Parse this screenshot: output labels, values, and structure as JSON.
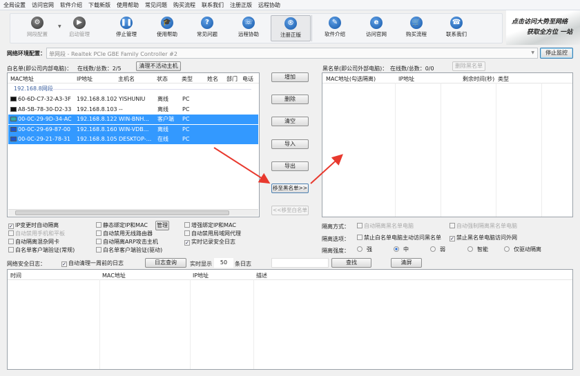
{
  "menu": [
    "全局设置",
    "访问官网",
    "软件介绍",
    "下载新版",
    "使用帮助",
    "常见问题",
    "购买流程",
    "联系我们",
    "注册正版",
    "远程协助"
  ],
  "toolbar": [
    {
      "label": "网段配置",
      "icon": "gear-icon",
      "glyph": "⚙",
      "disabled": true
    },
    {
      "label": "启动管理",
      "icon": "play-icon",
      "glyph": "▶",
      "disabled": true
    },
    {
      "label": "停止管理",
      "icon": "pause-icon",
      "glyph": "❚❚"
    },
    {
      "label": "使用帮助",
      "icon": "graduation-cap-icon",
      "glyph": "🎓"
    },
    {
      "label": "常见问题",
      "icon": "question-icon",
      "glyph": "?"
    },
    {
      "label": "远程协助",
      "icon": "remote-icon",
      "glyph": "☏"
    },
    {
      "label": "注册正版",
      "icon": "registered-icon",
      "glyph": "®",
      "selected": true
    },
    {
      "label": "软件介绍",
      "icon": "edit-icon",
      "glyph": "✎"
    },
    {
      "label": "访问官网",
      "icon": "ie-icon",
      "glyph": "e"
    },
    {
      "label": "购买流程",
      "icon": "cart-icon",
      "glyph": "🛒"
    },
    {
      "label": "联系我们",
      "icon": "phone-icon",
      "glyph": "☎"
    }
  ],
  "banner": {
    "line1": "点击访问大势至网络",
    "line2": "获取全方位 一站"
  },
  "network": {
    "label": "网络环境配置：",
    "value": "单网段 - Realtek PCIe GBE Family Controller #2",
    "stop_button": "停止监控"
  },
  "whitelist": {
    "title": "白名单(即公司内部电脑)：",
    "count": "在线数/总数：2/5",
    "clean_button": "清理不活动主机",
    "columns": [
      "MAC地址",
      "IP地址",
      "主机名",
      "状态",
      "类型",
      "姓名",
      "部门",
      "电话"
    ],
    "group": "192.168.8网段",
    "rows": [
      {
        "mac": "60-6D-C7-32-A3-3F",
        "ip": "192.168.8.102",
        "host": "YISHUNIU",
        "status": "离线",
        "type": "PC",
        "selected": false
      },
      {
        "mac": "A8-5B-78-30-D2-33",
        "ip": "192.168.8.103",
        "host": "--",
        "status": "离线",
        "type": "PC",
        "selected": false
      },
      {
        "mac": "00-0C-29-9D-34-AC",
        "ip": "192.168.8.122",
        "host": "WIN-BNH...",
        "status": "客户端",
        "type": "PC",
        "selected": true
      },
      {
        "mac": "00-0C-29-69-87-00",
        "ip": "192.168.8.160",
        "host": "WIN-VDB...",
        "status": "离线",
        "type": "PC",
        "selected": true
      },
      {
        "mac": "00-0C-29-21-78-31",
        "ip": "192.168.8.105",
        "host": "DESKTOP-...",
        "status": "在线",
        "type": "PC",
        "selected": true
      }
    ]
  },
  "middle_buttons": [
    "增加",
    "删除",
    "清空",
    "导入",
    "导出",
    "移至黑名单>>",
    "<<移至白名单"
  ],
  "blacklist": {
    "title": "黑名单(即公司外部电脑)：",
    "count": "在线数/总数：0/0",
    "delete_button": "删除黑名单",
    "columns": [
      "MAC地址(勾选隔离)",
      "IP地址",
      "剩余时间(秒)",
      "类型"
    ]
  },
  "options": [
    {
      "label": "IP变更时自动隔离",
      "checked": true
    },
    {
      "label": "静态绑定IP和MAC",
      "checked": false
    },
    {
      "label": "增强绑定IP和MAC",
      "checked": false
    },
    {
      "label": "自动禁用手机和平板",
      "checked": false,
      "disabled": true
    },
    {
      "label": "自动禁用无线路由器",
      "checked": false
    },
    {
      "label": "自动禁用局域网代理",
      "checked": false
    },
    {
      "label": "自动隔离混杂网卡",
      "checked": false
    },
    {
      "label": "自动隔离ARP攻击主机",
      "checked": false
    },
    {
      "label": "实时记录安全日志",
      "checked": true
    },
    {
      "label": "白名单客户端验证(常规)",
      "checked": false
    },
    {
      "label": "白名单客户端验证(驱动)",
      "checked": false
    }
  ],
  "manage_button": "管理",
  "isolation": {
    "mode_label": "隔离方式：",
    "mode": [
      {
        "label": "自动隔离黑名单电脑",
        "checked": false
      },
      {
        "label": "自动强制隔离黑名单电脑",
        "checked": false
      }
    ],
    "option_label": "隔离选项：",
    "option": [
      {
        "label": "禁止白名单电脑主动访问黑名单",
        "checked": false
      },
      {
        "label": "禁止黑名单电脑访问外网",
        "checked": true
      }
    ],
    "strength_label": "隔离强度：",
    "strength": [
      "强",
      "中",
      "弱",
      "智能",
      "仅驱动隔离"
    ],
    "strength_selected": "中"
  },
  "log": {
    "label": "网络安全日志：",
    "auto_clean": "自动清理一周前的日志",
    "auto_clean_checked": true,
    "query_button": "日志查询",
    "realtime_label": "实时显示",
    "realtime_value": "50",
    "realtime_unit": "条日志",
    "search_value": "",
    "find_button": "查找",
    "clear_button": "清屏",
    "columns": [
      "时间",
      "MAC地址",
      "IP地址",
      "描述"
    ]
  }
}
